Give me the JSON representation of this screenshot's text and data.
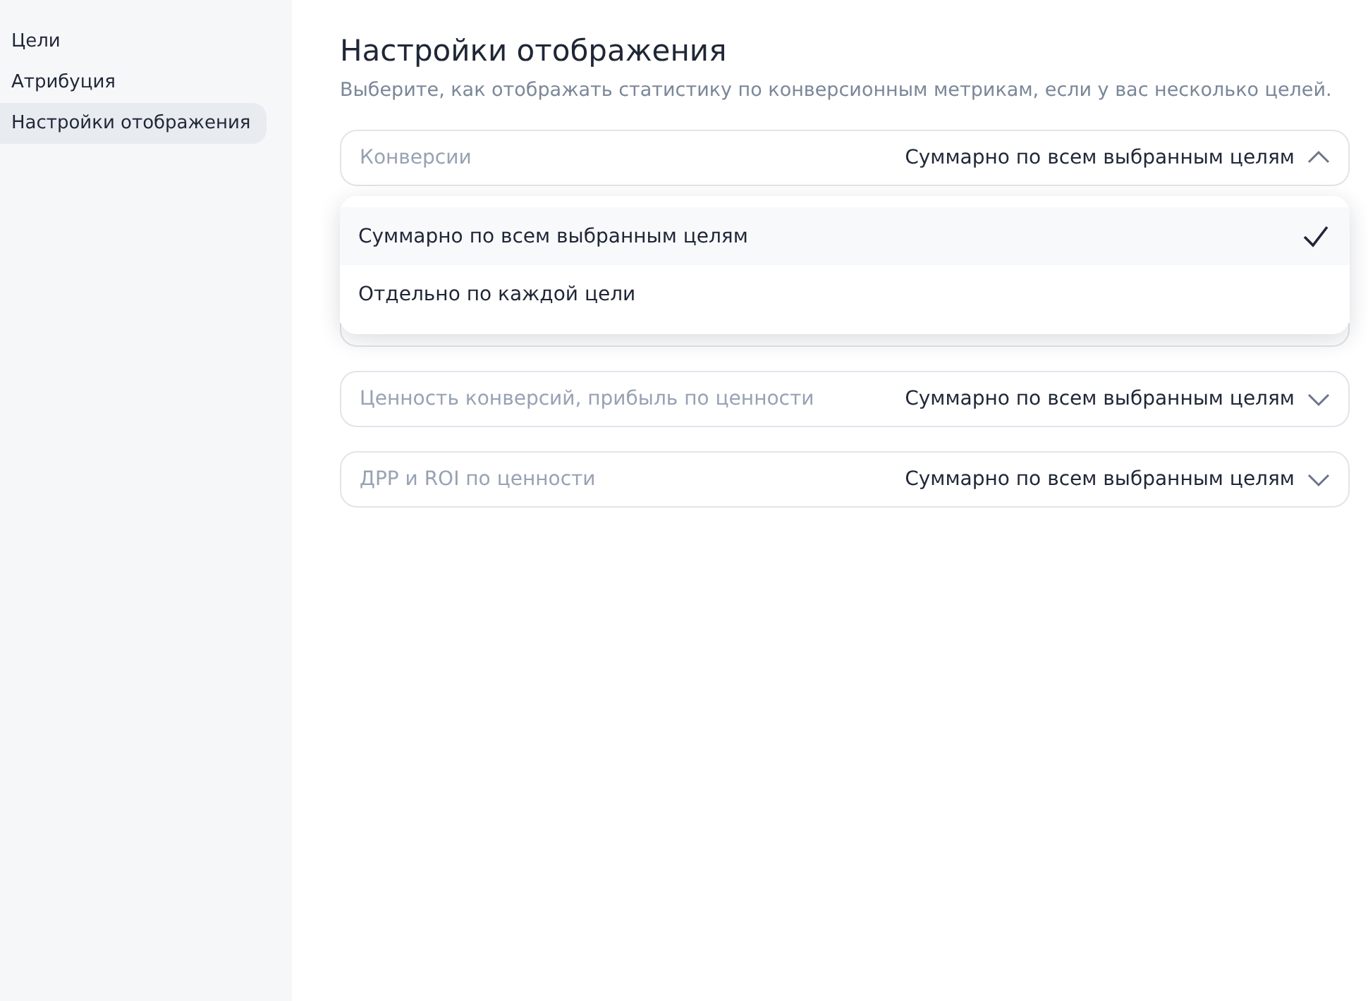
{
  "sidebar": {
    "items": [
      {
        "label": "Цели",
        "selected": false
      },
      {
        "label": "Атрибуция",
        "selected": false
      },
      {
        "label": "Настройки отображения",
        "selected": true
      }
    ]
  },
  "header": {
    "title": "Настройки отображения",
    "subtitle": "Выберите, как отображать статистику по конверсионным метрикам, если у вас несколько целей."
  },
  "settings": [
    {
      "label": "Конверсии",
      "value": "Суммарно по всем выбранным целям",
      "expanded": true
    },
    {
      "label": "Ценность конверсий, прибыль по ценности",
      "value": "Суммарно по всем выбранным целям",
      "expanded": false
    },
    {
      "label": "ДРР и ROI по ценности",
      "value": "Суммарно по всем выбранным целям",
      "expanded": false
    }
  ],
  "menu": {
    "options": [
      {
        "label": "Суммарно по всем выбранным целям",
        "selected": true
      },
      {
        "label": "Отдельно по каждой цели",
        "selected": false
      }
    ]
  }
}
